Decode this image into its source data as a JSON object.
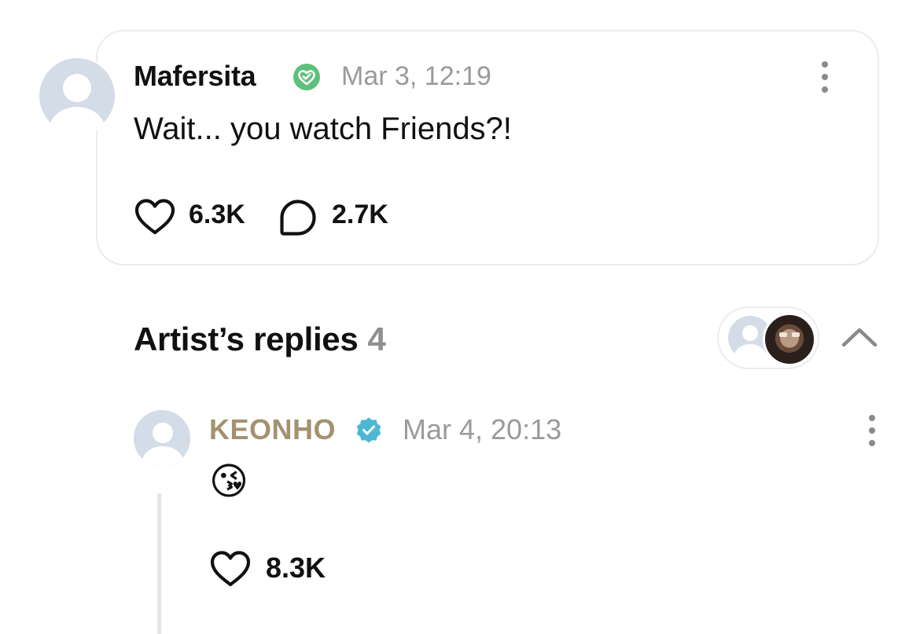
{
  "post": {
    "username": "Mafersita",
    "time": "Mar 3, 12:19",
    "text": "Wait... you watch Friends?!",
    "likes": "6.3K",
    "comments": "2.7K",
    "badge_color": "#5ec07a"
  },
  "artist_replies": {
    "title": "Artist’s replies",
    "count": "4"
  },
  "reply": {
    "username": "KEONHO",
    "time": "Mar 4, 20:13",
    "text": "😘",
    "likes": "8.3K",
    "username_color": "#a39270",
    "badge_color": "#4cb8d4"
  },
  "icons": {
    "post_badge": "heart-check-badge-icon",
    "reply_badge": "verified-badge-icon",
    "like": "heart-outline-icon",
    "comment": "speech-bubble-icon",
    "more": "vertical-dots-icon",
    "collapse": "chevron-up-icon"
  }
}
